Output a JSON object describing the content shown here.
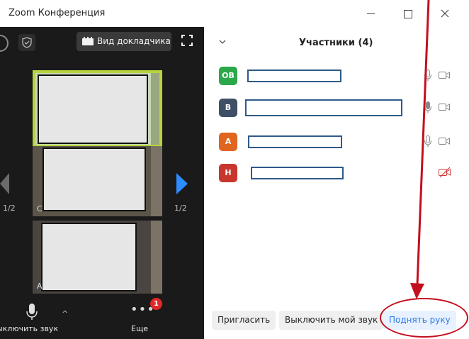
{
  "window": {
    "title": "Zoom Конференция"
  },
  "video": {
    "speaker_view_label": "Вид докладчика",
    "page_left": "1/2",
    "page_right": "1/2",
    "tiles": [
      {
        "letter": ""
      },
      {
        "letter": "С"
      },
      {
        "letter": "А"
      }
    ],
    "mute_label": "ыключить звук",
    "more_label": "Еще",
    "more_badge": "1"
  },
  "participants": {
    "title": "Участники (4)",
    "list": [
      {
        "initials": "ОВ",
        "color": "#2ca84a",
        "name": "",
        "mic": "on",
        "video": "on"
      },
      {
        "initials": "В",
        "color": "#3f4f66",
        "name": "",
        "mic": "on",
        "video": "on"
      },
      {
        "initials": "А",
        "color": "#e0651f",
        "name": "",
        "mic": "on",
        "video": "on"
      },
      {
        "initials": "Н",
        "color": "#c8372d",
        "name": "",
        "mic": "none",
        "video": "off"
      }
    ]
  },
  "actions": {
    "invite": "Пригласить",
    "mute_me": "Выключить мой звук",
    "raise_hand": "Поднять руку"
  },
  "colors": {
    "accent": "#2d8cff",
    "annotation_red": "#c40f1e",
    "active_speaker": "#b7d33f"
  }
}
